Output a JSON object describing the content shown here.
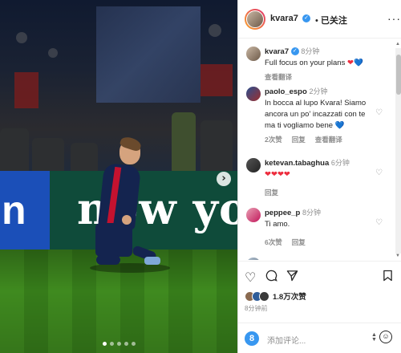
{
  "header": {
    "username": "kvara7",
    "separator": "•",
    "follow_label": "已关注",
    "more": "···"
  },
  "media": {
    "board_left_text": "n",
    "board_text": "now yo",
    "next_icon": "chevron-right-icon",
    "carousel_total": 5,
    "carousel_active": 1
  },
  "comments": [
    {
      "user": "kvara7",
      "time": "8分钟",
      "text": "Full focus on your plans",
      "emoji": [
        "❤",
        "💙"
      ],
      "actions": [
        "查看翻译"
      ]
    },
    {
      "user": "paolo_espo",
      "time": "2分钟",
      "text": "In bocca al lupo Kvara! Siamo ancora un po' incazzati con te ma ti vogliamo bene",
      "emoji": [
        "💙"
      ],
      "actions": [
        "2次赞",
        "回复",
        "查看翻译"
      ]
    },
    {
      "user": "ketevan.tabaghua",
      "time": "6分钟",
      "text": "",
      "emoji": [
        "❤",
        "❤",
        "❤",
        "❤"
      ],
      "actions": [
        "回复"
      ]
    },
    {
      "user": "peppee_p",
      "time": "8分钟",
      "text": "Ti amo.",
      "emoji": [],
      "actions": [
        "6次赞",
        "回复"
      ]
    }
  ],
  "actions": {
    "like_icon": "heart-outline-icon",
    "comment_icon": "comment-icon",
    "share_icon": "send-icon",
    "save_icon": "bookmark-icon",
    "likes_count": "1.8万次赞",
    "post_time": "8分钟前",
    "add_comment_placeholder": "添加评论..."
  },
  "colors": {
    "accent": "#3897f0",
    "red_heart": "#ed2d3e",
    "blue_heart": "#2b6fd6",
    "muted": "#8e8e8e"
  }
}
